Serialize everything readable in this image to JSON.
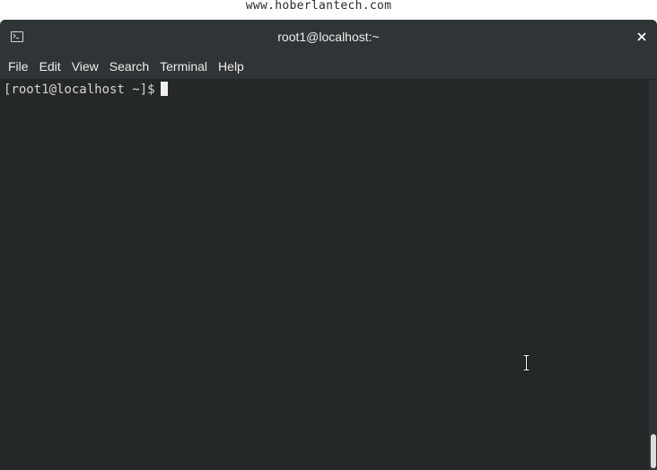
{
  "watermark": "www.hoberlantech.com",
  "window": {
    "title": "root1@localhost:~",
    "icon": "terminal-icon",
    "close_icon": "close-icon"
  },
  "menubar": {
    "items": [
      "File",
      "Edit",
      "View",
      "Search",
      "Terminal",
      "Help"
    ]
  },
  "terminal": {
    "prompt": "[root1@localhost ~]$",
    "input": ""
  },
  "colors": {
    "titlebar_bg": "#2f3436",
    "terminal_bg": "#252829",
    "text": "#d3d7cf",
    "cursor": "#eeeeec"
  }
}
